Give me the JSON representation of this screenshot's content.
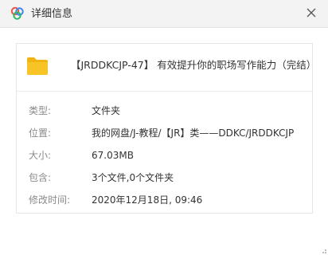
{
  "window": {
    "title": "详细信息",
    "icon": "cloud-icon",
    "close_icon": "close-icon"
  },
  "item": {
    "icon": "folder-icon",
    "name": "【JRDDKCJP-47】 有效提升你的职场写作能力（完结）"
  },
  "details": {
    "type": {
      "label": "类型:",
      "value": "文件夹"
    },
    "location": {
      "label": "位置:",
      "value": "我的网盘/J-教程/【JR】类——DDKC/JRDDKCJP"
    },
    "size": {
      "label": "大小:",
      "value": "67.03MB"
    },
    "contains": {
      "label": "包含:",
      "value": "3个文件,0个文件夹"
    },
    "modified": {
      "label": "修改时间:",
      "value": "2020年12月18日, 09:46"
    }
  },
  "colors": {
    "folder": "#f7c325",
    "cloud_blue": "#3d84f5",
    "cloud_red": "#ee5540",
    "cloud_green": "#2db76a",
    "label": "#8a8a8a",
    "text": "#333333"
  }
}
